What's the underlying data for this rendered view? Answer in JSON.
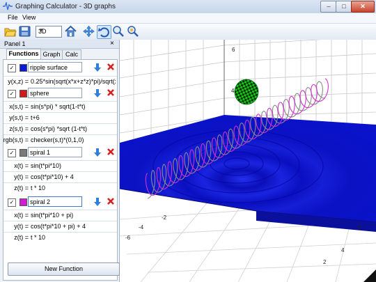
{
  "window": {
    "title": "Graphing Calculator - 3D graphs"
  },
  "menu": {
    "file": "File",
    "view": "View"
  },
  "toolbar": {
    "mode_value": "3D"
  },
  "panel": {
    "title": "Panel 1",
    "close": "×"
  },
  "tabs": {
    "functions": "Functions",
    "graph": "Graph",
    "calc": "Calc"
  },
  "functions": [
    {
      "name": "ripple surface",
      "color": "#0a1ad6",
      "eqs": [
        {
          "label": "y(x,z) =",
          "value": "0.25*sin(sqrt(x*x+z*z)*pi)/sqrt(x*x+"
        }
      ]
    },
    {
      "name": "sphere",
      "color": "#d21a1a",
      "eqs": [
        {
          "label": "x(s,t) =",
          "value": "sin(s*pi) * sqrt(1-t*t)"
        },
        {
          "label": "y(s,t) =",
          "value": "t+6"
        },
        {
          "label": "z(s,t) =",
          "value": "cos(s*pi) *sqrt (1-t*t)"
        },
        {
          "label": "rgb(s,t) =",
          "value": "checker(s,t)*(0,1,0)"
        }
      ]
    },
    {
      "name": "spiral 1",
      "color": "#7a7a7a",
      "eqs": [
        {
          "label": "x(t) =",
          "value": "sin(t*pi*10)"
        },
        {
          "label": "y(t) =",
          "value": "cos(t*pi*10) + 4"
        },
        {
          "label": "z(t) =",
          "value": "t * 10"
        }
      ]
    },
    {
      "name": "spiral 2",
      "color": "#d51ad5",
      "eqs": [
        {
          "label": "x(t) =",
          "value": "sin(t*pi*10 +  pi)"
        },
        {
          "label": "y(t) =",
          "value": "cos(t*pi*10 +  pi) + 4"
        },
        {
          "label": "z(t) =",
          "value": "t * 10"
        }
      ]
    }
  ],
  "new_function": "New Function",
  "axis_labels": {
    "y6": "6",
    "y4": "4",
    "y2": "2",
    "x_m6": "-6",
    "x_m4": "-4",
    "x_m2": "-2",
    "x_2": "2",
    "x_4": "4",
    "x_6": "6"
  },
  "colors": {
    "surface": "#0a0fc8",
    "sphere": "#18d018",
    "spiral1": "#8a8a8a",
    "spiral2": "#cc33cc"
  }
}
